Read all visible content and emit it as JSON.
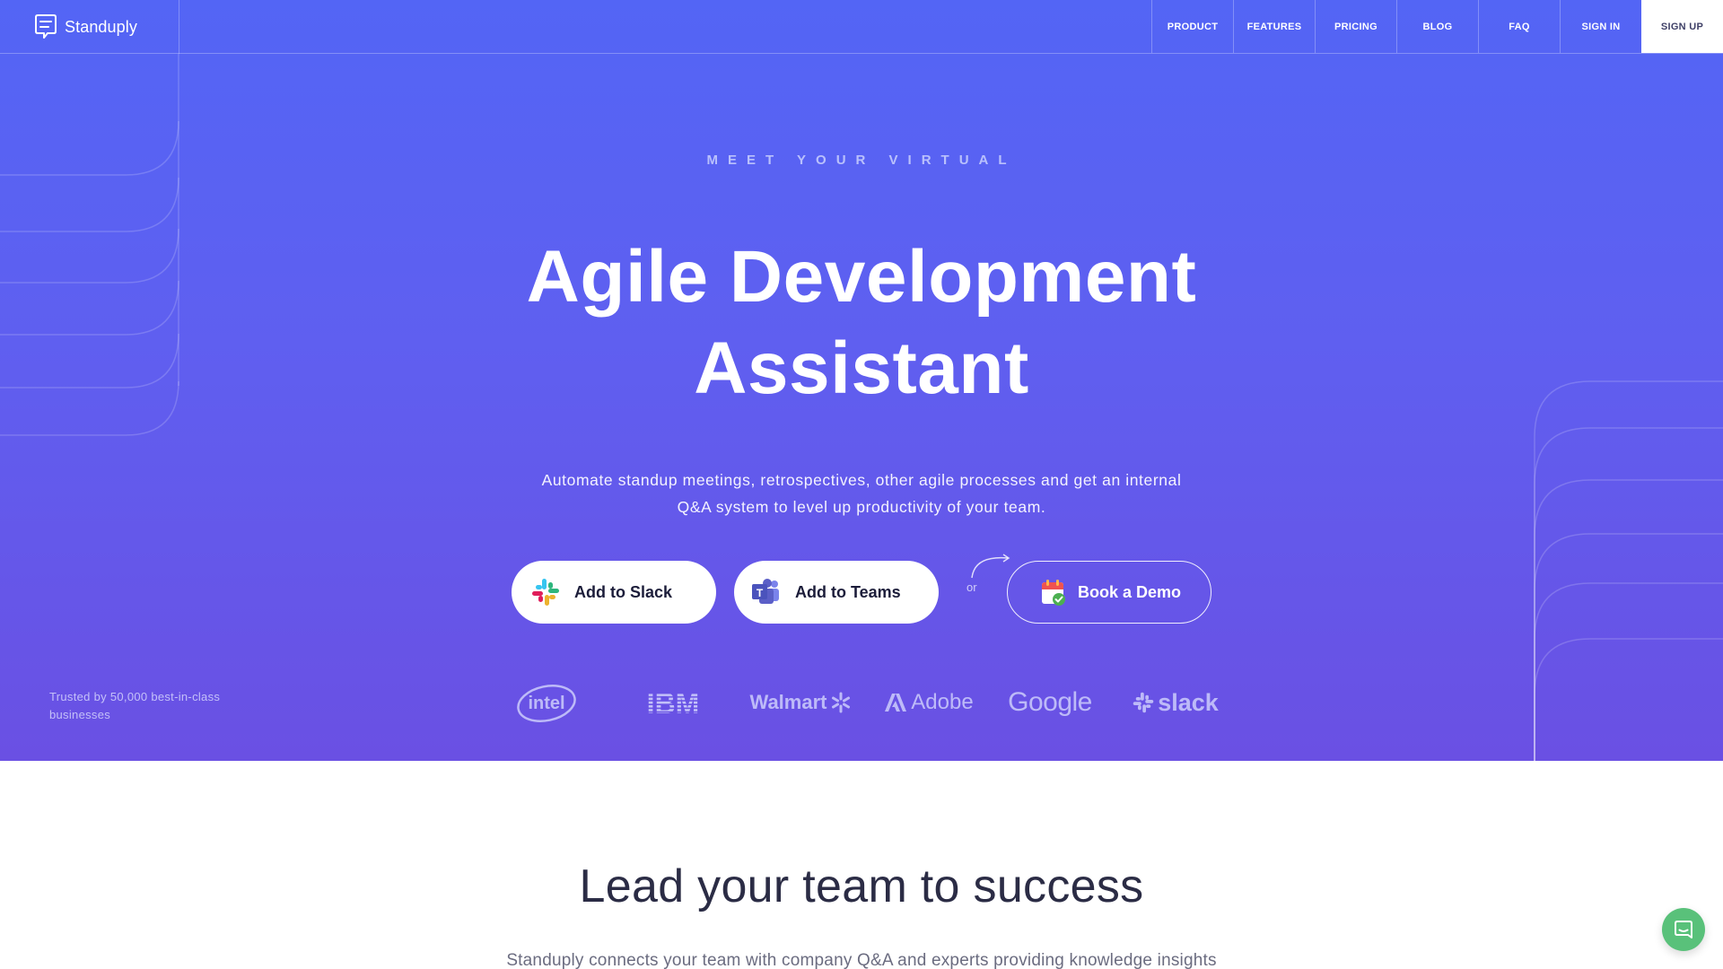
{
  "brand": {
    "name": "Standuply",
    "icon": "speech-bubble-icon"
  },
  "nav": {
    "items": [
      "PRODUCT",
      "FEATURES",
      "PRICING",
      "BLOG",
      "FAQ",
      "SIGN IN"
    ],
    "signup": "SIGN UP"
  },
  "hero": {
    "eyebrow": "MEET YOUR VIRTUAL",
    "headline_line1": "Agile Development",
    "headline_line2": "Assistant",
    "subtitle_line1": "Automate standup meetings, retrospectives, other agile processes and get an internal",
    "subtitle_line2": "Q&A system to level up productivity of your team.",
    "buttons": {
      "slack": "Add to Slack",
      "teams": "Add to Teams",
      "or": "or",
      "demo": "Book a Demo"
    },
    "trusted": "Trusted by 50,000 best-in-class businesses",
    "logos": {
      "intel": "intel",
      "ibm": "IBM",
      "walmart": "Walmart",
      "adobe": "Adobe",
      "google": "Google",
      "slack": "slack"
    }
  },
  "section": {
    "title": "Lead your team to success",
    "subtitle": "Standuply connects your team with company Q&A and experts providing knowledge insights"
  },
  "colors": {
    "hero_top": "#5365f5",
    "hero_bottom": "#6a50e3",
    "chat_button": "#59c17a"
  }
}
